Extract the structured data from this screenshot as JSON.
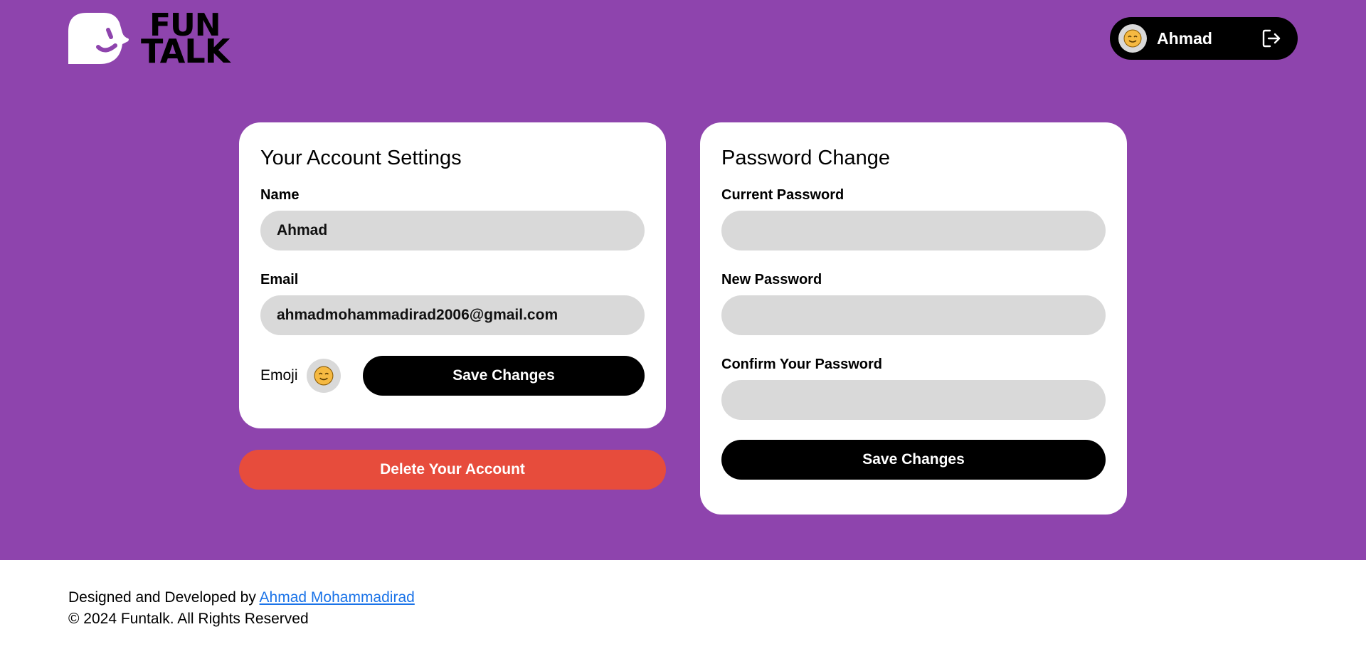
{
  "brand": {
    "logo_line1": "FUN",
    "logo_line2": "TALK"
  },
  "header": {
    "user_name": "Ahmad",
    "avatar_icon": "smiling-face-icon",
    "logout_icon": "logout-icon"
  },
  "account_settings": {
    "title": "Your Account Settings",
    "name_label": "Name",
    "name_value": "Ahmad",
    "email_label": "Email",
    "email_value": "ahmadmohammadirad2006@gmail.com",
    "emoji_label": "Emoji",
    "save_label": "Save Changes"
  },
  "delete_label": "Delete Your Account",
  "password_change": {
    "title": "Password Change",
    "current_label": "Current Password",
    "new_label": "New Password",
    "confirm_label": "Confirm Your Password",
    "save_label": "Save Changes"
  },
  "footer": {
    "designed_by": "Designed and Developed by",
    "author": "Ahmad Mohammadirad",
    "copyright": "© 2024 Funtalk. All Rights Reserved"
  },
  "colors": {
    "background_purple": "#8e44ad",
    "danger_red": "#e74c3c",
    "input_gray": "#d9d9d9",
    "link_blue": "#1a73e8"
  }
}
